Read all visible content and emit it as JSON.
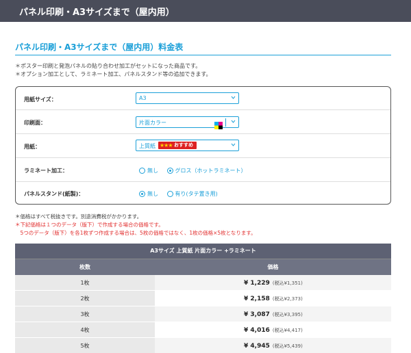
{
  "header": {
    "title": "パネル印刷・A3サイズまで（屋内用）"
  },
  "section": {
    "title": "パネル印刷・A3サイズまで（屋内用）料金表"
  },
  "notes": [
    "＊ポスター印刷と発泡パネルの貼り合わせ加工がセットになった商品です。",
    "＊オプション加工として、ラミネート加工、パネルスタンド等の追加できます。"
  ],
  "form": {
    "paper_size": {
      "label": "用紙サイズ：",
      "value": "A3"
    },
    "print_side": {
      "label": "印刷面：",
      "value": "片面カラー"
    },
    "paper": {
      "label": "用紙：",
      "value": "上質紙",
      "badge": "おすすめ",
      "badge_stars": "★★★"
    },
    "laminate": {
      "label": "ラミネート加工：",
      "options": [
        "無し",
        "グロス（ホットラミネート）"
      ],
      "selected": 1
    },
    "stand": {
      "label": "パネルスタンド(紙製)：",
      "options": [
        "無し",
        "有り(タテ置き用)"
      ],
      "selected": 0
    }
  },
  "price_notes": [
    "＊価格はすべて税抜きです。別途消費税がかかります。",
    "＊下記価格は１つのデータ（版下）で作成する場合の価格です。",
    "　5つのデータ（版下）を各1枚ずつ作成する場合は、5枚の価格ではなく、1枚の価格×5枚となります。"
  ],
  "table": {
    "title": "A3サイズ 上質紙 片面カラー +ラミネート",
    "headers": [
      "枚数",
      "価格"
    ],
    "rows": [
      {
        "qty": "1枚",
        "price": "¥ 1,229",
        "tax": "(税込¥1,351)"
      },
      {
        "qty": "2枚",
        "price": "¥ 2,158",
        "tax": "(税込¥2,373)"
      },
      {
        "qty": "3枚",
        "price": "¥ 3,087",
        "tax": "(税込¥3,395)"
      },
      {
        "qty": "4枚",
        "price": "¥ 4,016",
        "tax": "(税込¥4,417)"
      },
      {
        "qty": "5枚",
        "price": "¥ 4,945",
        "tax": "(税込¥5,439)"
      }
    ]
  },
  "colors": {
    "accent": "#1a9fd8",
    "header_bg": "#4a4d5a",
    "table_title_bg": "#5d6173",
    "note_red": "#e23030"
  }
}
